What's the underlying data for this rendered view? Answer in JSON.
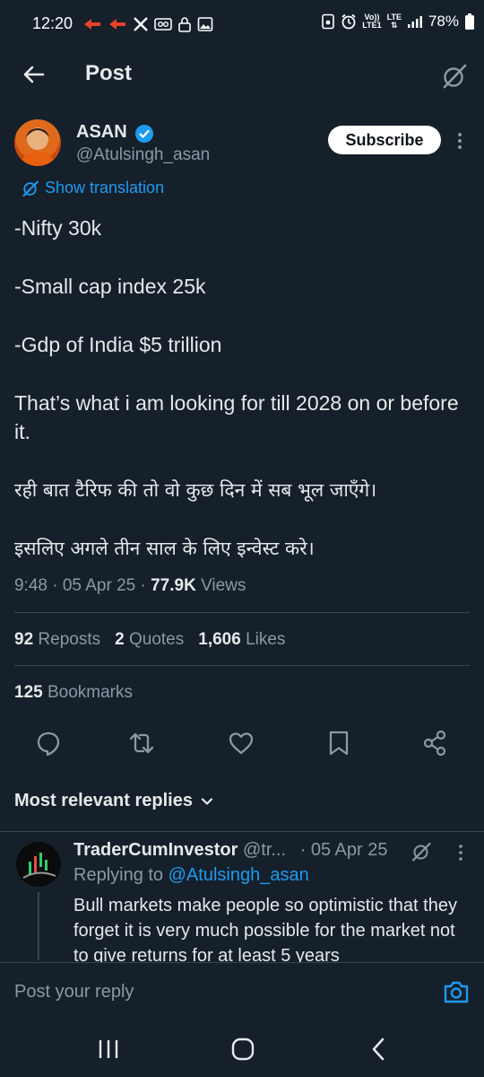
{
  "status_bar": {
    "time": "12:20",
    "battery": "78%",
    "lte_top": "Vo))",
    "lte_bottom": "LTE1",
    "lte_label": "LTE"
  },
  "header": {
    "title": "Post"
  },
  "author": {
    "name": "ASAN",
    "handle": "@Atulsingh_asan",
    "subscribe_label": "Subscribe"
  },
  "translation": {
    "label": "Show translation"
  },
  "post": {
    "lines": [
      "-Nifty 30k",
      "-Small cap index 25k",
      "-Gdp of India $5 trillion",
      "That’s what i am looking for till 2028 on or before it.",
      "रही बात टैरिफ की तो वो कुछ दिन में सब भूल जाएँगे।",
      "इसलिए अगले तीन साल के लिए इन्वेस्ट करे।"
    ],
    "time": "9:48 · 05 Apr 25 · ",
    "views_count": "77.9K",
    "views_label": " Views"
  },
  "stats": {
    "reposts_count": "92",
    "reposts_label": "Reposts",
    "quotes_count": "2",
    "quotes_label": "Quotes",
    "likes_count": "1,606",
    "likes_label": "Likes",
    "bookmarks_count": "125",
    "bookmarks_label": "Bookmarks"
  },
  "actions": [
    "reply-icon",
    "repost-icon",
    "like-icon",
    "bookmark-icon",
    "share-icon"
  ],
  "replies_sort": {
    "label": "Most relevant replies"
  },
  "reply": {
    "name": "TraderCumInvestor",
    "handle": "@tr...",
    "date": "· 05 Apr 25",
    "replying_prefix": "Replying to ",
    "replying_to": "@Atulsingh_asan",
    "text": "Bull markets make people so optimistic that they forget it is very much possible for the market not to give returns for at least 5 years"
  },
  "composer": {
    "placeholder": "Post your reply"
  },
  "colors": {
    "background": "#15202b",
    "accent": "#1d9bf0",
    "muted": "#8b98a5",
    "text": "#e7e9ea",
    "divider": "#38444d"
  }
}
